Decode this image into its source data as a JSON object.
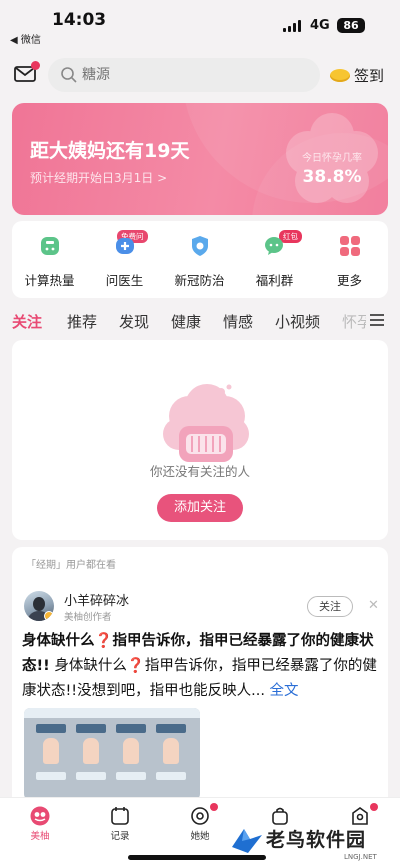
{
  "status_bar": {
    "time": "14:03",
    "back_app": "◀ 微信",
    "network": "4G",
    "battery": "86"
  },
  "top_bar": {
    "search_placeholder": "糖源",
    "signin_label": "签到"
  },
  "hero": {
    "title": "距大姨妈还有19天",
    "subtitle": "预计经期开始日3月1日 >",
    "pregnancy_label": "今日怀孕几率",
    "pregnancy_value": "38.8%",
    "gradient": [
      "#f07596",
      "#f48ba6"
    ]
  },
  "shortcuts": [
    {
      "label": "计算热量",
      "icon": "calculator-icon",
      "badge": ""
    },
    {
      "label": "问医生",
      "icon": "doctor-icon",
      "badge": "免费问"
    },
    {
      "label": "新冠防治",
      "icon": "shield-icon",
      "badge": ""
    },
    {
      "label": "福利群",
      "icon": "chat-icon",
      "badge": "红包"
    },
    {
      "label": "更多",
      "icon": "grid-icon",
      "badge": ""
    }
  ],
  "tabs": [
    "关注",
    "推荐",
    "发现",
    "健康",
    "情感",
    "小视频",
    "怀孕"
  ],
  "empty_state": {
    "message": "你还没有关注的人",
    "button": "添加关注"
  },
  "feed": {
    "source": "「经期」用户都在看",
    "author": "小羊碎碎冰",
    "author_role": "美柚创作者",
    "follow_label": "关注",
    "close_label": "✕",
    "article_bold": "身体缺什么❓指甲告诉你，指甲已经暴露了你的健康状态!!",
    "article_body": " 身体缺什么❓指甲告诉你，指甲已经暴露了你的健康状态!!没想到吧，指甲也能反映人...",
    "article_more": " 全文"
  },
  "tabbar": [
    {
      "label": "美柚",
      "icon": "meiyou-logo-icon",
      "active": true,
      "dot": false
    },
    {
      "label": "记录",
      "icon": "calendar-icon",
      "active": false,
      "dot": false
    },
    {
      "label": "她她",
      "icon": "community-icon",
      "active": false,
      "dot": true
    },
    {
      "label": "",
      "icon": "shopping-bag-icon",
      "active": false,
      "dot": false
    },
    {
      "label": "",
      "icon": "profile-icon",
      "active": false,
      "dot": true
    }
  ],
  "watermark": {
    "text": "老鸟软件园",
    "url": "LNGJ.NET"
  },
  "colors": {
    "accent": "#e84a73",
    "link": "#2a6ed6",
    "badge": "#e8365d"
  }
}
